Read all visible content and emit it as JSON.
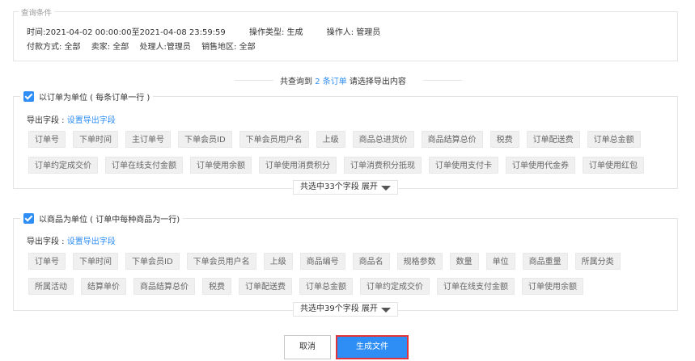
{
  "query": {
    "legend": "查询条件",
    "time": "时间:2021-04-02 00:00:00至2021-04-08 23:59:59",
    "op_type": "操作类型: 生成",
    "operator": "操作人: 管理员",
    "payment": "付款方式: 全部",
    "seller": "卖家: 全部",
    "handler": "处理人:管理员",
    "region": "销售地区: 全部"
  },
  "result": {
    "prefix": "共查询到",
    "count_link": "2 条订单",
    "suffix": "请选择导出内容"
  },
  "order_section": {
    "title": "以订单为单位 ( 每条订单一行 )",
    "checked": true,
    "export_label": "导出字段 : ",
    "export_link": "设置导出字段",
    "row1": [
      "订单号",
      "下单时间",
      "主订单号",
      "下单会员ID",
      "下单会员用户名",
      "上级",
      "商品总进货价",
      "商品结算总价",
      "税费",
      "订单配送费",
      "订单总金额"
    ],
    "row2": [
      "订单约定成交价",
      "订单在线支付金额",
      "订单使用余额",
      "订单使用消费积分",
      "订单消费积分抵现",
      "订单使用支付卡",
      "订单使用代金券",
      "订单使用红包"
    ],
    "expand_label": "共选中33个字段 展开"
  },
  "product_section": {
    "title": "以商品为单位 ( 订单中每种商品为一行)",
    "checked": true,
    "export_label": "导出字段 : ",
    "export_link": "设置导出字段",
    "row1": [
      "订单号",
      "下单时间",
      "下单会员ID",
      "下单会员用户名",
      "上级",
      "商品编号",
      "商品名",
      "规格参数",
      "数量",
      "单位",
      "商品重量",
      "所属分类"
    ],
    "row2": [
      "所属活动",
      "结算单价",
      "商品结算总价",
      "税费",
      "订单配送费",
      "订单总金额",
      "订单约定成交价",
      "订单在线支付金额",
      "订单使用余额"
    ],
    "expand_label": "共选中39个字段 展开"
  },
  "buttons": {
    "cancel": "取消",
    "generate": "生成文件"
  },
  "colors": {
    "accent": "#2f8ef5",
    "highlight_border": "#e0343a"
  }
}
